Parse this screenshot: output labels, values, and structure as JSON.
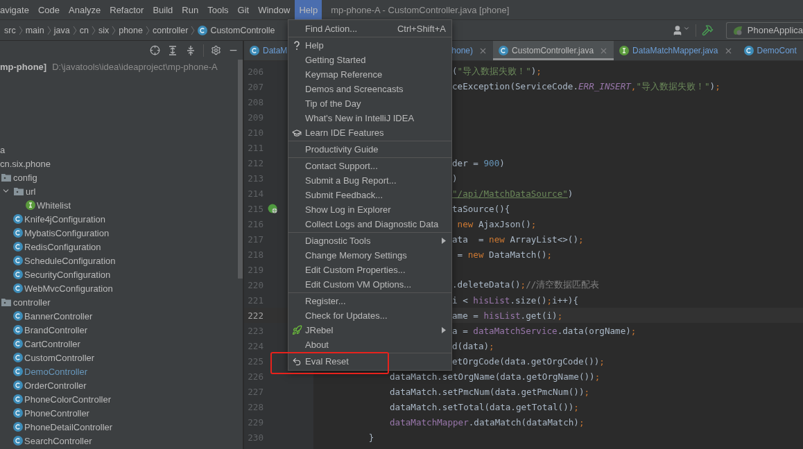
{
  "menu_bar": {
    "items": [
      {
        "label": "avigate",
        "selected": false
      },
      {
        "label": "Code",
        "selected": false
      },
      {
        "label": "Analyze",
        "selected": false
      },
      {
        "label": "Refactor",
        "selected": false
      },
      {
        "label": "Build",
        "selected": false
      },
      {
        "label": "Run",
        "selected": false
      },
      {
        "label": "Tools",
        "selected": false
      },
      {
        "label": "Git",
        "selected": false
      },
      {
        "label": "Window",
        "selected": false
      },
      {
        "label": "Help",
        "selected": true
      }
    ],
    "title": "mp-phone-A - CustomController.java [phone]"
  },
  "breadcrumbs": [
    {
      "label": "src"
    },
    {
      "label": "main"
    },
    {
      "label": "java"
    },
    {
      "label": "cn"
    },
    {
      "label": "six"
    },
    {
      "label": "phone"
    },
    {
      "label": "controller"
    },
    {
      "label": "CustomControlle",
      "kind": "class"
    }
  ],
  "toolbar": {
    "run_config": "PhoneApplica"
  },
  "project_panel": {
    "root": {
      "name": "mp-phone]",
      "path": "D:\\javatools\\idea\\ideaproject\\mp-phone-A"
    },
    "tree": [
      {
        "label": "a",
        "children": [
          {
            "label": "cn.six.phone",
            "children": [
              {
                "label": "config",
                "kind": "folder",
                "children": [
                  {
                    "label": "url",
                    "kind": "folder",
                    "expanded": true,
                    "children": [
                      {
                        "label": "Whitelist",
                        "kind": "interface",
                        "modified": false
                      }
                    ]
                  },
                  {
                    "label": "Knife4jConfiguration",
                    "kind": "class",
                    "modified": false
                  },
                  {
                    "label": "MybatisConfiguration",
                    "kind": "class",
                    "modified": false
                  },
                  {
                    "label": "RedisConfiguration",
                    "kind": "class",
                    "modified": false
                  },
                  {
                    "label": "ScheduleConfiguration",
                    "kind": "class",
                    "modified": false
                  },
                  {
                    "label": "SecurityConfiguration",
                    "kind": "class",
                    "modified": false
                  },
                  {
                    "label": "WebMvcConfiguration",
                    "kind": "class",
                    "modified": false
                  }
                ]
              },
              {
                "label": "controller",
                "kind": "folder",
                "children": [
                  {
                    "label": "BannerController",
                    "kind": "class",
                    "modified": false
                  },
                  {
                    "label": "BrandController",
                    "kind": "class",
                    "modified": false
                  },
                  {
                    "label": "CartController",
                    "kind": "class",
                    "modified": false
                  },
                  {
                    "label": "CustomController",
                    "kind": "class",
                    "modified": false
                  },
                  {
                    "label": "DemoController",
                    "kind": "class",
                    "modified": true
                  },
                  {
                    "label": "OrderController",
                    "kind": "class",
                    "modified": false
                  },
                  {
                    "label": "PhoneColorController",
                    "kind": "class",
                    "modified": false
                  },
                  {
                    "label": "PhoneController",
                    "kind": "class",
                    "modified": false
                  },
                  {
                    "label": "PhoneDetailController",
                    "kind": "class",
                    "modified": false
                  },
                  {
                    "label": "SearchController",
                    "kind": "class",
                    "modified": false
                  }
                ]
              }
            ]
          }
        ]
      }
    ]
  },
  "editor": {
    "tabs": [
      {
        "parts": [
          "DataM",
          "hone)"
        ],
        "kind": "class",
        "selected": false,
        "closable": true
      },
      {
        "parts": [
          "CustomController.java"
        ],
        "kind": "class",
        "selected": true,
        "closable": true
      },
      {
        "parts": [
          "DataMatchMapper.java"
        ],
        "kind": "interface",
        "selected": false,
        "closable": true
      },
      {
        "parts": [
          "DemoCont"
        ],
        "kind": "class",
        "selected": false,
        "closable": false
      }
    ],
    "lines": [
      {
        "no": "206",
        "clipped": true,
        "current": false,
        "tokens": [
          {
            "text": "(",
            "kind": "plain"
          },
          {
            "text": "\"导入数据失败！\"",
            "kind": "str"
          },
          {
            "text": ")",
            "kind": "plain"
          },
          {
            "text": ";",
            "kind": "kw"
          }
        ]
      },
      {
        "no": "207",
        "clipped": true,
        "current": false,
        "tokens": [
          {
            "text": "ceException(ServiceCode.",
            "kind": "plain"
          },
          {
            "text": "ERR_INSERT",
            "kind": "const"
          },
          {
            "text": ",",
            "kind": "kw"
          },
          {
            "text": "\"导入数据失败！\"",
            "kind": "str"
          },
          {
            "text": ")",
            "kind": "plain"
          },
          {
            "text": ";",
            "kind": "kw"
          }
        ]
      },
      {
        "no": "208",
        "current": false
      },
      {
        "no": "209",
        "current": false
      },
      {
        "no": "210",
        "current": false
      },
      {
        "no": "211",
        "current": false
      },
      {
        "no": "212",
        "clipped": true,
        "current": false,
        "tokens": [
          {
            "text": "der = ",
            "kind": "plain"
          },
          {
            "text": "900",
            "kind": "num"
          },
          {
            "text": ")",
            "kind": "plain"
          }
        ]
      },
      {
        "no": "213",
        "clipped": true,
        "current": false,
        "tokens": [
          {
            "text": ")",
            "kind": "plain"
          }
        ]
      },
      {
        "no": "214",
        "clipped": true,
        "current": false,
        "tokens": [
          {
            "text": "\"/api/MatchDataSource\"",
            "kind": "link"
          },
          {
            "text": ")",
            "kind": "plain"
          }
        ]
      },
      {
        "no": "215",
        "clipped": true,
        "current": false,
        "kind": "endpoint",
        "tokens": [
          {
            "text": "taSource(){",
            "kind": "plain"
          }
        ]
      },
      {
        "no": "216",
        "clipped": true,
        "current": false,
        "tokens": [
          {
            "text": " new",
            "kind": "kw"
          },
          {
            "text": " AjaxJson()",
            "kind": "plain"
          },
          {
            "text": ";",
            "kind": "kw"
          }
        ]
      },
      {
        "no": "217",
        "clipped": true,
        "current": false,
        "tokens": [
          {
            "text": "ata  = ",
            "kind": "plain"
          },
          {
            "text": "new",
            "kind": "kw"
          },
          {
            "text": " ArrayList<>()",
            "kind": "plain"
          },
          {
            "text": ";",
            "kind": "kw"
          }
        ]
      },
      {
        "no": "218",
        "clipped": true,
        "current": false,
        "tokens": [
          {
            "text": " = ",
            "kind": "plain"
          },
          {
            "text": "new",
            "kind": "kw"
          },
          {
            "text": " DataMatch()",
            "kind": "plain"
          },
          {
            "text": ";",
            "kind": "kw"
          }
        ]
      },
      {
        "no": "219",
        "current": false
      },
      {
        "no": "220",
        "clipped": true,
        "current": false,
        "tokens": [
          {
            "text": ".deleteData()",
            "kind": "plain"
          },
          {
            "text": ";",
            "kind": "kw"
          },
          {
            "text": "//清空数据匹配表",
            "kind": "comment"
          }
        ]
      },
      {
        "no": "221",
        "clipped": true,
        "current": false,
        "tokens": [
          {
            "text": "i < ",
            "kind": "plain"
          },
          {
            "text": "hisList",
            "kind": "field"
          },
          {
            "text": ".size()",
            "kind": "plain"
          },
          {
            "text": ";",
            "kind": "kw"
          },
          {
            "text": "i++){",
            "kind": "plain"
          }
        ]
      },
      {
        "no": "222",
        "clipped": true,
        "current": true,
        "tokens": [
          {
            "text": "ame = ",
            "kind": "plain"
          },
          {
            "text": "hisList",
            "kind": "field"
          },
          {
            "text": ".get(i)",
            "kind": "plain"
          },
          {
            "text": ";",
            "kind": "kw"
          }
        ]
      },
      {
        "no": "223",
        "clipped": true,
        "current": false,
        "tokens": [
          {
            "text": "a = ",
            "kind": "plain"
          },
          {
            "text": "dataMatchService",
            "kind": "field"
          },
          {
            "text": ".data(orgName)",
            "kind": "plain"
          },
          {
            "text": ";",
            "kind": "kw"
          }
        ]
      },
      {
        "no": "224",
        "clipped": true,
        "current": false,
        "tokens": [
          {
            "text": "d(data)",
            "kind": "plain"
          },
          {
            "text": ";",
            "kind": "kw"
          }
        ]
      },
      {
        "no": "225",
        "clipped": true,
        "current": false,
        "tokens": [
          {
            "text": "etOrgCode(data.getOrgCode())",
            "kind": "plain"
          },
          {
            "text": ";",
            "kind": "kw"
          }
        ]
      },
      {
        "no": "226",
        "current": false,
        "tokens": [
          {
            "text": "            dataMatch.setOrgName(data.getOrgName())",
            "kind": "plain"
          },
          {
            "text": ";",
            "kind": "kw"
          }
        ]
      },
      {
        "no": "227",
        "current": false,
        "tokens": [
          {
            "text": "            dataMatch.setPmcNum(data.getPmcNum())",
            "kind": "plain"
          },
          {
            "text": ";",
            "kind": "kw"
          }
        ]
      },
      {
        "no": "228",
        "current": false,
        "tokens": [
          {
            "text": "            dataMatch.setTotal(data.getTotal())",
            "kind": "plain"
          },
          {
            "text": ";",
            "kind": "kw"
          }
        ]
      },
      {
        "no": "229",
        "current": false,
        "tokens": [
          {
            "text": "            dataMatchMapper",
            "kind": "field"
          },
          {
            "text": ".dataMatch(dataMatch)",
            "kind": "plain"
          },
          {
            "text": ";",
            "kind": "kw"
          }
        ]
      },
      {
        "no": "230",
        "current": false,
        "tokens": [
          {
            "text": "        }",
            "kind": "plain"
          }
        ]
      }
    ]
  },
  "help_menu": {
    "groups": [
      [
        {
          "label": "Find Action...",
          "shortcut": "Ctrl+Shift+A",
          "submenu": false
        }
      ],
      [
        {
          "label": "Help",
          "kind": "help",
          "submenu": false
        },
        {
          "label": "Getting Started",
          "submenu": false
        },
        {
          "label": "Keymap Reference",
          "submenu": false
        },
        {
          "label": "Demos and Screencasts",
          "submenu": false
        },
        {
          "label": "Tip of the Day",
          "submenu": false
        },
        {
          "label": "What's New in IntelliJ IDEA",
          "submenu": false
        },
        {
          "label": "Learn IDE Features",
          "kind": "learn",
          "submenu": false
        }
      ],
      [
        {
          "label": "Productivity Guide",
          "submenu": false
        }
      ],
      [
        {
          "label": "Contact Support...",
          "submenu": false
        },
        {
          "label": "Submit a Bug Report...",
          "submenu": false
        },
        {
          "label": "Submit Feedback...",
          "submenu": false
        },
        {
          "label": "Show Log in Explorer",
          "submenu": false
        },
        {
          "label": "Collect Logs and Diagnostic Data",
          "submenu": false
        }
      ],
      [
        {
          "label": "Diagnostic Tools",
          "submenu": true
        },
        {
          "label": "Change Memory Settings",
          "submenu": false
        },
        {
          "label": "Edit Custom Properties...",
          "submenu": false
        },
        {
          "label": "Edit Custom VM Options...",
          "submenu": false
        }
      ],
      [
        {
          "label": "Register...",
          "submenu": false
        },
        {
          "label": "Check for Updates...",
          "submenu": false
        },
        {
          "label": "JRebel",
          "kind": "jrebel",
          "submenu": true
        },
        {
          "label": "About",
          "submenu": false
        }
      ],
      [
        {
          "label": "Eval Reset",
          "kind": "reset",
          "submenu": false
        }
      ]
    ]
  }
}
